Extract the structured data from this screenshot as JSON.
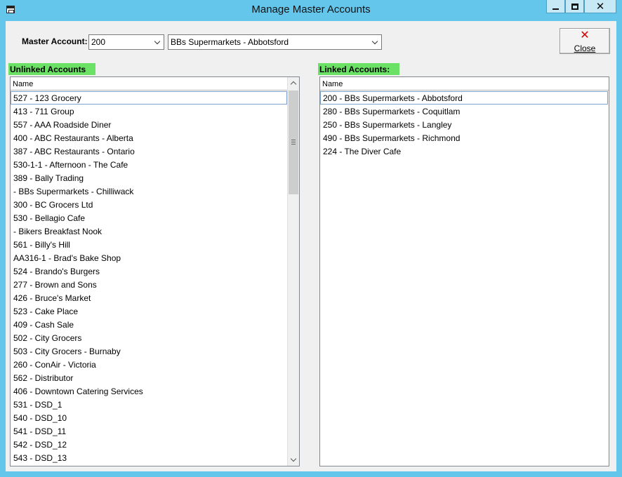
{
  "window": {
    "title": "Manage Master Accounts",
    "icon": "app-window-icon"
  },
  "controls": {
    "master_account_label": "Master Account:",
    "code_value": "200",
    "name_value": "BBs Supermarkets - Abbotsford",
    "close_label": "Close",
    "close_icon": "red-x-icon"
  },
  "unlinked": {
    "label": "Unlinked Accounts",
    "column": "Name",
    "items": [
      "527 - 123 Grocery",
      "413 - 711 Group",
      "557 - AAA Roadside Diner",
      "400 - ABC Restaurants - Alberta",
      "387 - ABC Restaurants - Ontario",
      "530-1-1 - Afternoon - The Cafe",
      "389 - Bally Trading",
      " - BBs Supermarkets - Chilliwack",
      "300 - BC Grocers Ltd",
      "530 - Bellagio Cafe",
      " - Bikers Breakfast Nook",
      "561 - Billy's Hill",
      "AA316-1 - Brad's Bake Shop",
      "524 - Brando's Burgers",
      "277 - Brown and Sons",
      "426 - Bruce's Market",
      "523 - Cake Place",
      "409 - Cash Sale",
      "502 - City Grocers",
      "503 - City Grocers - Burnaby",
      "260 - ConAir - Victoria",
      "562 - Distributor",
      "406 - Downtown Catering Services",
      "531 - DSD_1",
      "540 - DSD_10",
      "541 - DSD_11",
      "542 - DSD_12",
      "543 - DSD_13"
    ]
  },
  "linked": {
    "label": "Linked Accounts:",
    "column": "Name",
    "items": [
      "200 - BBs Supermarkets - Abbotsford",
      "280 - BBs Supermarkets - Coquitlam",
      "250 - BBs Supermarkets - Langley",
      "490 - BBs Supermarkets - Richmond",
      "224 - The Diver Cafe"
    ]
  },
  "colors": {
    "titlebar": "#65c6ec",
    "section_highlight": "#6be165",
    "close_x": "#d10000"
  }
}
